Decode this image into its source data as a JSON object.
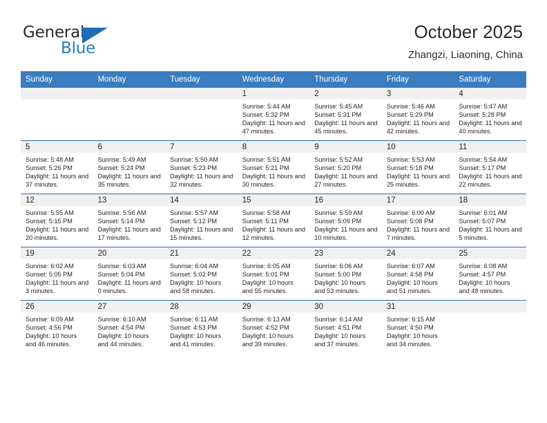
{
  "brand": {
    "name_part1": "General",
    "name_part2": "Blue",
    "logo_icon": "triangle-logo-icon"
  },
  "header": {
    "title": "October 2025",
    "subtitle": "Zhangzi, Liaoning, China"
  },
  "colors": {
    "header_blue": "#3a7dbf",
    "row_divider_blue": "#2f6ca8",
    "daynum_strip_gray": "#f0f0f0",
    "brand_blue": "#1f7fc4",
    "text": "#231f20"
  },
  "calendar": {
    "weekday_headers": [
      "Sunday",
      "Monday",
      "Tuesday",
      "Wednesday",
      "Thursday",
      "Friday",
      "Saturday"
    ],
    "labels": {
      "sunrise": "Sunrise:",
      "sunset": "Sunset:",
      "daylight": "Daylight:"
    },
    "weeks": [
      [
        {
          "day": "",
          "empty": true
        },
        {
          "day": "",
          "empty": true
        },
        {
          "day": "",
          "empty": true
        },
        {
          "day": "1",
          "sunrise": "Sunrise: 5:44 AM",
          "sunset": "Sunset: 5:32 PM",
          "daylight": "Daylight: 11 hours and 47 minutes."
        },
        {
          "day": "2",
          "sunrise": "Sunrise: 5:45 AM",
          "sunset": "Sunset: 5:31 PM",
          "daylight": "Daylight: 11 hours and 45 minutes."
        },
        {
          "day": "3",
          "sunrise": "Sunrise: 5:46 AM",
          "sunset": "Sunset: 5:29 PM",
          "daylight": "Daylight: 11 hours and 42 minutes."
        },
        {
          "day": "4",
          "sunrise": "Sunrise: 5:47 AM",
          "sunset": "Sunset: 5:28 PM",
          "daylight": "Daylight: 11 hours and 40 minutes."
        }
      ],
      [
        {
          "day": "5",
          "sunrise": "Sunrise: 5:48 AM",
          "sunset": "Sunset: 5:26 PM",
          "daylight": "Daylight: 11 hours and 37 minutes."
        },
        {
          "day": "6",
          "sunrise": "Sunrise: 5:49 AM",
          "sunset": "Sunset: 5:24 PM",
          "daylight": "Daylight: 11 hours and 35 minutes."
        },
        {
          "day": "7",
          "sunrise": "Sunrise: 5:50 AM",
          "sunset": "Sunset: 5:23 PM",
          "daylight": "Daylight: 11 hours and 32 minutes."
        },
        {
          "day": "8",
          "sunrise": "Sunrise: 5:51 AM",
          "sunset": "Sunset: 5:21 PM",
          "daylight": "Daylight: 11 hours and 30 minutes."
        },
        {
          "day": "9",
          "sunrise": "Sunrise: 5:52 AM",
          "sunset": "Sunset: 5:20 PM",
          "daylight": "Daylight: 11 hours and 27 minutes."
        },
        {
          "day": "10",
          "sunrise": "Sunrise: 5:53 AM",
          "sunset": "Sunset: 5:18 PM",
          "daylight": "Daylight: 11 hours and 25 minutes."
        },
        {
          "day": "11",
          "sunrise": "Sunrise: 5:54 AM",
          "sunset": "Sunset: 5:17 PM",
          "daylight": "Daylight: 11 hours and 22 minutes."
        }
      ],
      [
        {
          "day": "12",
          "sunrise": "Sunrise: 5:55 AM",
          "sunset": "Sunset: 5:15 PM",
          "daylight": "Daylight: 11 hours and 20 minutes."
        },
        {
          "day": "13",
          "sunrise": "Sunrise: 5:56 AM",
          "sunset": "Sunset: 5:14 PM",
          "daylight": "Daylight: 11 hours and 17 minutes."
        },
        {
          "day": "14",
          "sunrise": "Sunrise: 5:57 AM",
          "sunset": "Sunset: 5:12 PM",
          "daylight": "Daylight: 11 hours and 15 minutes."
        },
        {
          "day": "15",
          "sunrise": "Sunrise: 5:58 AM",
          "sunset": "Sunset: 5:11 PM",
          "daylight": "Daylight: 11 hours and 12 minutes."
        },
        {
          "day": "16",
          "sunrise": "Sunrise: 5:59 AM",
          "sunset": "Sunset: 5:09 PM",
          "daylight": "Daylight: 11 hours and 10 minutes."
        },
        {
          "day": "17",
          "sunrise": "Sunrise: 6:00 AM",
          "sunset": "Sunset: 5:08 PM",
          "daylight": "Daylight: 11 hours and 7 minutes."
        },
        {
          "day": "18",
          "sunrise": "Sunrise: 6:01 AM",
          "sunset": "Sunset: 5:07 PM",
          "daylight": "Daylight: 11 hours and 5 minutes."
        }
      ],
      [
        {
          "day": "19",
          "sunrise": "Sunrise: 6:02 AM",
          "sunset": "Sunset: 5:05 PM",
          "daylight": "Daylight: 11 hours and 3 minutes."
        },
        {
          "day": "20",
          "sunrise": "Sunrise: 6:03 AM",
          "sunset": "Sunset: 5:04 PM",
          "daylight": "Daylight: 11 hours and 0 minutes."
        },
        {
          "day": "21",
          "sunrise": "Sunrise: 6:04 AM",
          "sunset": "Sunset: 5:02 PM",
          "daylight": "Daylight: 10 hours and 58 minutes."
        },
        {
          "day": "22",
          "sunrise": "Sunrise: 6:05 AM",
          "sunset": "Sunset: 5:01 PM",
          "daylight": "Daylight: 10 hours and 55 minutes."
        },
        {
          "day": "23",
          "sunrise": "Sunrise: 6:06 AM",
          "sunset": "Sunset: 5:00 PM",
          "daylight": "Daylight: 10 hours and 53 minutes."
        },
        {
          "day": "24",
          "sunrise": "Sunrise: 6:07 AM",
          "sunset": "Sunset: 4:58 PM",
          "daylight": "Daylight: 10 hours and 51 minutes."
        },
        {
          "day": "25",
          "sunrise": "Sunrise: 6:08 AM",
          "sunset": "Sunset: 4:57 PM",
          "daylight": "Daylight: 10 hours and 48 minutes."
        }
      ],
      [
        {
          "day": "26",
          "sunrise": "Sunrise: 6:09 AM",
          "sunset": "Sunset: 4:56 PM",
          "daylight": "Daylight: 10 hours and 46 minutes."
        },
        {
          "day": "27",
          "sunrise": "Sunrise: 6:10 AM",
          "sunset": "Sunset: 4:54 PM",
          "daylight": "Daylight: 10 hours and 44 minutes."
        },
        {
          "day": "28",
          "sunrise": "Sunrise: 6:11 AM",
          "sunset": "Sunset: 4:53 PM",
          "daylight": "Daylight: 10 hours and 41 minutes."
        },
        {
          "day": "29",
          "sunrise": "Sunrise: 6:13 AM",
          "sunset": "Sunset: 4:52 PM",
          "daylight": "Daylight: 10 hours and 39 minutes."
        },
        {
          "day": "30",
          "sunrise": "Sunrise: 6:14 AM",
          "sunset": "Sunset: 4:51 PM",
          "daylight": "Daylight: 10 hours and 37 minutes."
        },
        {
          "day": "31",
          "sunrise": "Sunrise: 6:15 AM",
          "sunset": "Sunset: 4:50 PM",
          "daylight": "Daylight: 10 hours and 34 minutes."
        },
        {
          "day": "",
          "empty": true
        }
      ]
    ]
  }
}
